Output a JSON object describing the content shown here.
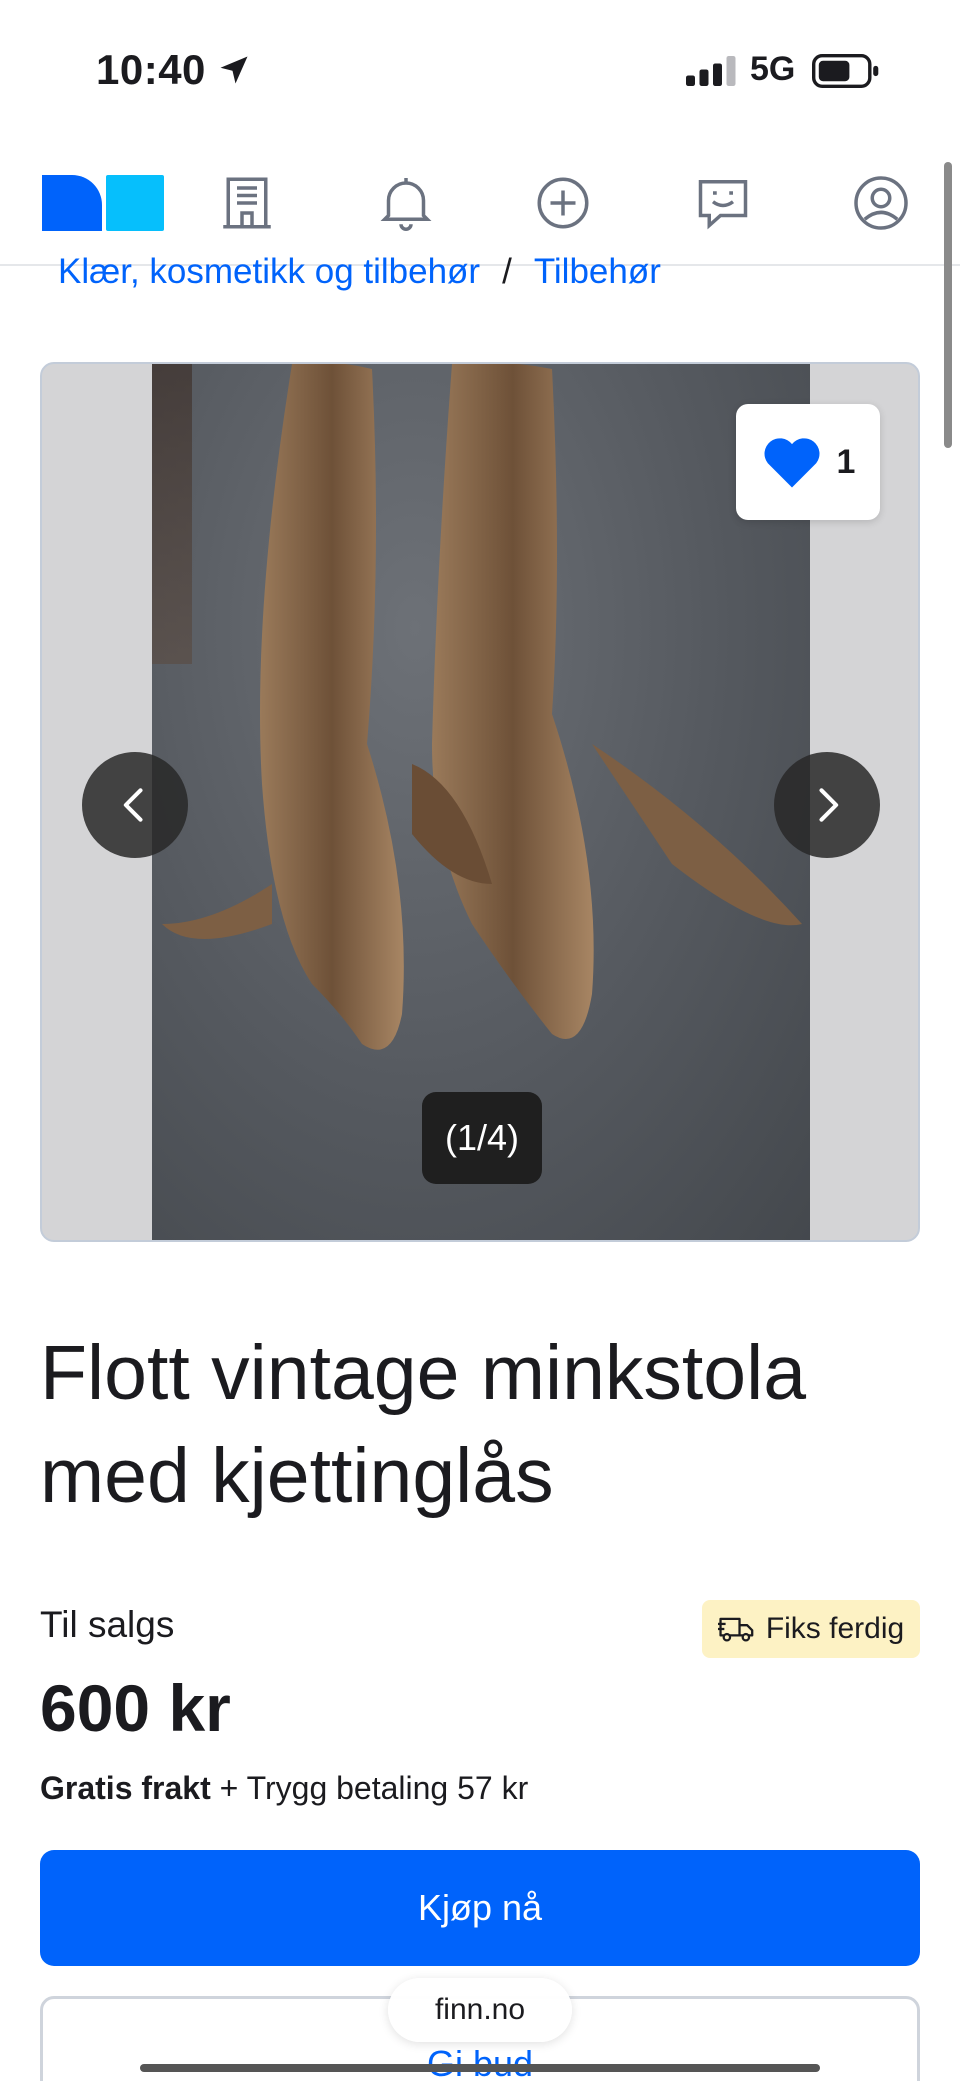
{
  "status_bar": {
    "time": "10:40",
    "network": "5G"
  },
  "breadcrumb": {
    "parent": "Klær, kosmetikk og tilbehør",
    "separator": "/",
    "current": "Tilbehør"
  },
  "gallery": {
    "favorite_count": "1",
    "image_counter": "(1/4)"
  },
  "listing": {
    "title": "Flott vintage minkstola med kjettinglås",
    "sale_type": "Til salgs",
    "badge": "Fiks ferdig",
    "price": "600 kr",
    "shipping_strong": "Gratis frakt",
    "shipping_rest": " + Trygg betaling 57 kr"
  },
  "actions": {
    "buy_label": "Kjøp nå",
    "bid_label": "Gi bud"
  },
  "browser": {
    "domain": "finn.no"
  },
  "colors": {
    "brand_blue": "#0063fb",
    "logo_light_blue": "#06bffc",
    "badge_bg": "#fdf2c4"
  },
  "icons": [
    "location-arrow-icon",
    "signal-icon",
    "battery-icon",
    "finn-logo",
    "building-icon",
    "bell-icon",
    "plus-circle-icon",
    "chat-icon",
    "profile-icon",
    "heart-icon",
    "chevron-left-icon",
    "chevron-right-icon",
    "truck-icon"
  ]
}
